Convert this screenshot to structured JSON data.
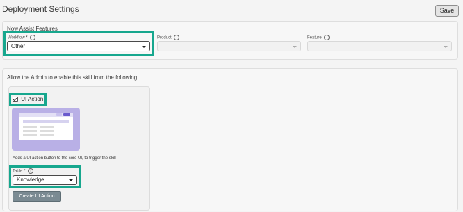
{
  "page": {
    "title": "Deployment Settings",
    "save_label": "Save"
  },
  "now_assist": {
    "title": "Now Assist Features",
    "workflow": {
      "label": "Workflow",
      "required": "*",
      "value": "Other"
    },
    "product": {
      "label": "Product",
      "value": ""
    },
    "feature": {
      "label": "Feature",
      "value": ""
    }
  },
  "enable": {
    "title": "Allow the Admin to enable this skill from the following",
    "ui_action": {
      "checkbox_label": "UI Action",
      "checked": true,
      "description": "Adds a UI action button to the core UI, to trigger the skill",
      "table": {
        "label": "Table",
        "required": "*",
        "value": "Knowledge"
      },
      "create_label": "Create UI Action"
    }
  },
  "colors": {
    "highlight": "#17a78e",
    "illustration": "#b9b0e6",
    "button": "#7a8a92"
  },
  "icons": [
    "info-icon",
    "chevron-down-icon",
    "checkbox-checked-icon"
  ]
}
